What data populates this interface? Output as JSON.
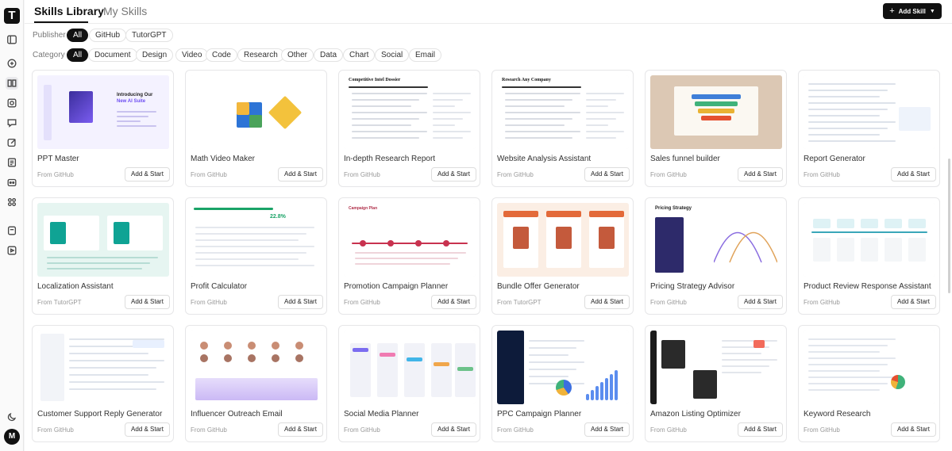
{
  "app": {
    "logo_letter": "T",
    "avatar_letter": "M"
  },
  "header": {
    "tabs": [
      {
        "label": "Skills Library",
        "active": true
      },
      {
        "label": "My Skills",
        "active": false
      }
    ],
    "add_skill_label": "Add Skill"
  },
  "filters": {
    "publisher": {
      "label": "Publisher",
      "options": [
        "All",
        "GitHub",
        "TutorGPT"
      ],
      "selected": "All"
    },
    "category": {
      "label": "Category",
      "options": [
        "All",
        "Document",
        "Design",
        "Video",
        "Code",
        "Research",
        "Other",
        "Data",
        "Chart",
        "Social",
        "Email"
      ],
      "selected": "All"
    }
  },
  "cards": [
    {
      "title": "PPT Master",
      "source": "From GitHub",
      "action": "Add & Start",
      "thumb": "ppt",
      "thumb_text": [
        "Introducing Our",
        "New AI Suite"
      ]
    },
    {
      "title": "Math Video Maker",
      "source": "From GitHub",
      "action": "Add & Start",
      "thumb": "math"
    },
    {
      "title": "In-depth Research Report",
      "source": "From GitHub",
      "action": "Add & Start",
      "thumb": "doc",
      "thumb_text": [
        "Competitive Intel Dossier"
      ]
    },
    {
      "title": "Website Analysis Assistant",
      "source": "From GitHub",
      "action": "Add & Start",
      "thumb": "doc",
      "thumb_text": [
        "Research Any Company"
      ]
    },
    {
      "title": "Sales funnel builder",
      "source": "From GitHub",
      "action": "Add & Start",
      "thumb": "funnel"
    },
    {
      "title": "Report Generator",
      "source": "From GitHub",
      "action": "Add & Start",
      "thumb": "table"
    },
    {
      "title": "Localization Assistant",
      "source": "From TutorGPT",
      "action": "Add & Start",
      "thumb": "teal"
    },
    {
      "title": "Profit Calculator",
      "source": "From GitHub",
      "action": "Add & Start",
      "thumb": "profit",
      "thumb_text": [
        "22.8%"
      ]
    },
    {
      "title": "Promotion Campaign Planner",
      "source": "From GitHub",
      "action": "Add & Start",
      "thumb": "timeline",
      "thumb_text": [
        "Campaign Plan"
      ]
    },
    {
      "title": "Bundle Offer Generator",
      "source": "From TutorGPT",
      "action": "Add & Start",
      "thumb": "bundle"
    },
    {
      "title": "Pricing Strategy Advisor",
      "source": "From GitHub",
      "action": "Add & Start",
      "thumb": "pricing",
      "thumb_text": [
        "Pricing Strategy"
      ]
    },
    {
      "title": "Product Review Response Assistant",
      "source": "From GitHub",
      "action": "Add & Start",
      "thumb": "flow"
    },
    {
      "title": "Customer Support Reply Generator",
      "source": "From GitHub",
      "action": "Add & Start",
      "thumb": "support"
    },
    {
      "title": "Influencer Outreach Email",
      "source": "From GitHub",
      "action": "Add & Start",
      "thumb": "influencer"
    },
    {
      "title": "Social Media Planner",
      "source": "From GitHub",
      "action": "Add & Start",
      "thumb": "social"
    },
    {
      "title": "PPC Campaign Planner",
      "source": "From GitHub",
      "action": "Add & Start",
      "thumb": "ppc"
    },
    {
      "title": "Amazon Listing Optimizer",
      "source": "From GitHub",
      "action": "Add & Start",
      "thumb": "amazon"
    },
    {
      "title": "Keyword Research",
      "source": "From GitHub",
      "action": "Add & Start",
      "thumb": "keyword"
    }
  ],
  "colors": {
    "primary": "#111111",
    "chip_border": "#e3e3e3",
    "muted_text": "#999999",
    "accent_purple": "#6d4df2",
    "accent_teal": "#0fa394"
  },
  "icons": {
    "rail": [
      "sidebar-toggle-icon",
      "chat-icon",
      "book-icon",
      "image-icon",
      "message-icon",
      "edit-icon",
      "document-icon",
      "robot-icon",
      "apps-icon",
      "note-icon",
      "media-icon",
      "theme-icon"
    ]
  }
}
